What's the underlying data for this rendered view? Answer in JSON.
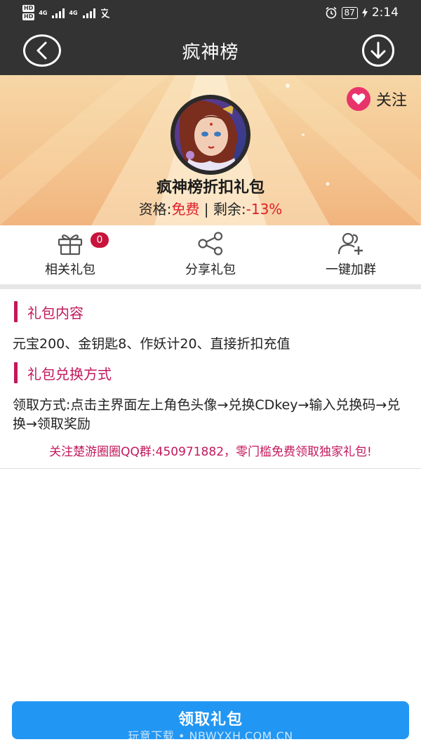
{
  "status_bar": {
    "hd": [
      "HD",
      "HD"
    ],
    "network": [
      "4G",
      "4G"
    ],
    "battery": "87",
    "time": "2:14"
  },
  "header": {
    "title": "疯神榜",
    "icons": {
      "back": "back-arrow-icon",
      "download": "download-icon"
    }
  },
  "banner": {
    "follow_label": "关注",
    "gift_name": "疯神榜折扣礼包",
    "qualify_label": "资格:",
    "qualify_value": "免费",
    "separator": " | ",
    "remain_label": "剩余:",
    "remain_value": "-13%"
  },
  "actions": [
    {
      "label": "相关礼包",
      "badge": "0",
      "icon": "gift-icon"
    },
    {
      "label": "分享礼包",
      "icon": "share-icon"
    },
    {
      "label": "一键加群",
      "icon": "add-group-icon"
    }
  ],
  "content": {
    "section1_title": "礼包内容",
    "section1_body": "元宝200、金钥匙8、作妖计20、直接折扣充值",
    "section2_title": "礼包兑换方式",
    "section2_body": "领取方式:点击主界面左上角色头像→兑换CDkey→输入兑换码→兑换→领取奖励",
    "promo": "关注楚游圈圈QQ群:450971882，零门槛免费领取独家礼包!"
  },
  "bottom": {
    "claim_label": "领取礼包",
    "watermark": "玩意下载 • NBWYXH.COM.CN"
  },
  "colors": {
    "header_bg": "#333333",
    "accent_red": "#e01e2a",
    "section_accent": "#c2185b",
    "button_blue": "#2196f3"
  }
}
